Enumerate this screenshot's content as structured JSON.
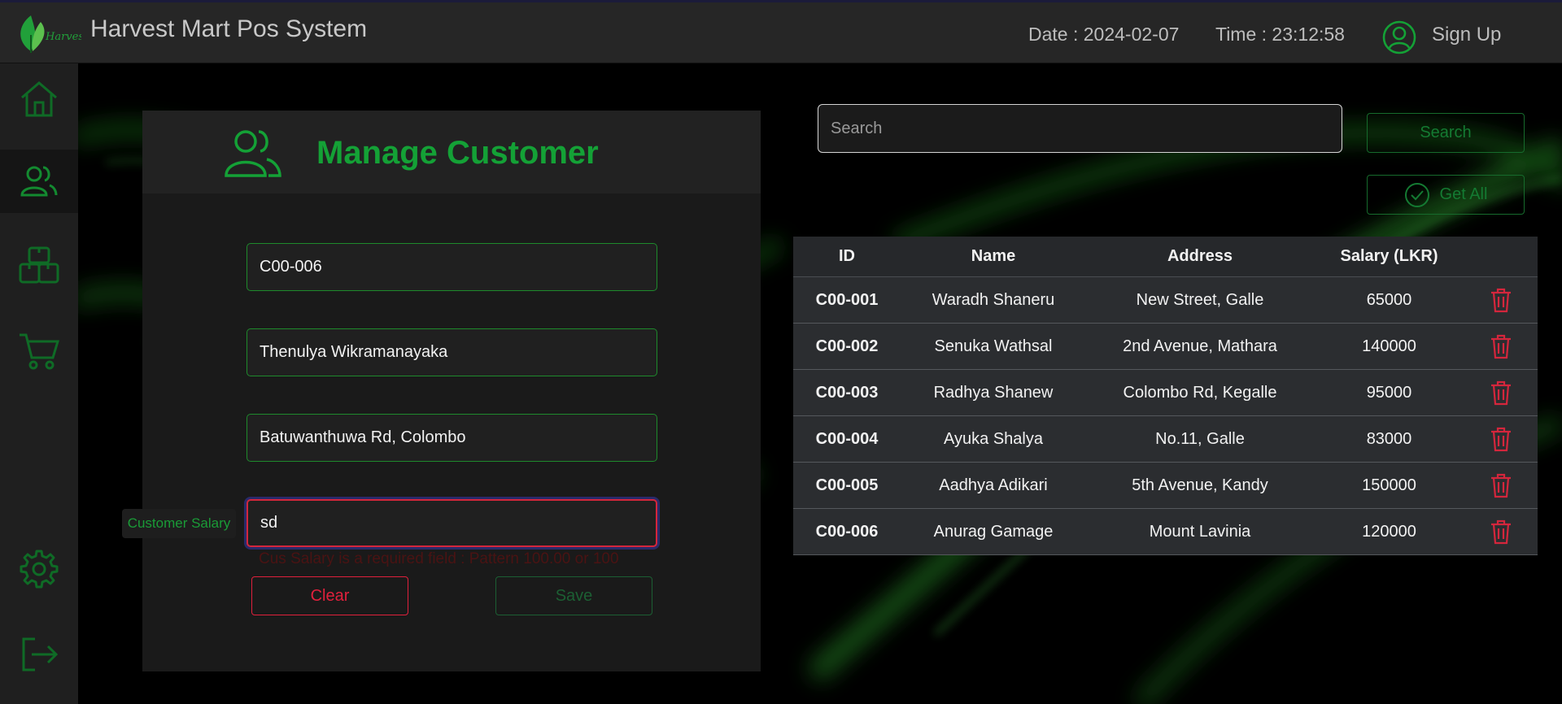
{
  "header": {
    "title": "Harvest Mart Pos System",
    "logo_text": "Harvest",
    "date": "Date : 2024-02-07",
    "time": "Time : 23:12:58",
    "signup_label": "Sign Up"
  },
  "sidebar": {
    "items": [
      {
        "icon": "home-icon"
      },
      {
        "icon": "users-icon",
        "active": true
      },
      {
        "icon": "boxes-icon"
      },
      {
        "icon": "cart-icon"
      },
      {
        "icon": "gear-icon"
      },
      {
        "icon": "logout-icon"
      }
    ]
  },
  "form": {
    "title": "Manage Customer",
    "id_value": "C00-006",
    "name_value": "Thenulya Wikramanayaka",
    "address_value": "Batuwanthuwa Rd, Colombo",
    "salary_label": "Customer Salary",
    "salary_value": "sd",
    "salary_error": "Cus Salary is a required field : Pattern 100.00 or 100",
    "clear_label": "Clear",
    "save_label": "Save"
  },
  "search": {
    "placeholder": "Search",
    "button_label": "Search",
    "get_all_label": "Get All"
  },
  "table": {
    "columns": [
      "ID",
      "Name",
      "Address",
      "Salary (LKR)"
    ],
    "rows": [
      {
        "id": "C00-001",
        "name": "Waradh Shaneru",
        "address": "New Street, Galle",
        "salary": "65000"
      },
      {
        "id": "C00-002",
        "name": "Senuka Wathsal",
        "address": "2nd Avenue, Mathara",
        "salary": "140000"
      },
      {
        "id": "C00-003",
        "name": "Radhya Shanew",
        "address": "Colombo Rd, Kegalle",
        "salary": "95000"
      },
      {
        "id": "C00-004",
        "name": "Ayuka Shalya",
        "address": "No.11, Galle",
        "salary": "83000"
      },
      {
        "id": "C00-005",
        "name": "Aadhya Adikari",
        "address": "5th Avenue, Kandy",
        "salary": "150000"
      },
      {
        "id": "C00-006",
        "name": "Anurag Gamage",
        "address": "Mount Lavinia",
        "salary": "120000"
      }
    ]
  },
  "colors": {
    "accent": "#14a136",
    "danger": "#e0203c",
    "background": "#000000"
  }
}
